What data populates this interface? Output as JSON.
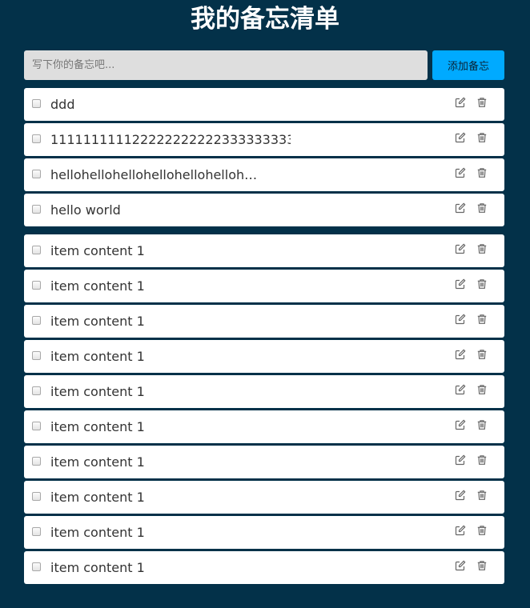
{
  "header": {
    "title": "我的备忘清单"
  },
  "composer": {
    "placeholder": "写下你的备忘吧...",
    "value": "",
    "add_label": "添加备忘"
  },
  "icons": {
    "edit": "edit-icon",
    "delete": "trash-icon"
  },
  "colors": {
    "background": "#033149",
    "accent_button": "#00aaff",
    "input_background": "#dedede",
    "item_background": "#ffffff"
  },
  "memos": [
    {
      "text": "ddd",
      "checked": false
    },
    {
      "text": "11111111112222222222233333333333…",
      "checked": false
    },
    {
      "text": "hellohellohellohellohellohelloh…",
      "checked": false
    },
    {
      "text": "hello world",
      "checked": false
    },
    {
      "text": "item content 1",
      "checked": false
    },
    {
      "text": "item content 1",
      "checked": false
    },
    {
      "text": "item content 1",
      "checked": false
    },
    {
      "text": "item content 1",
      "checked": false
    },
    {
      "text": "item content 1",
      "checked": false
    },
    {
      "text": "item content 1",
      "checked": false
    },
    {
      "text": "item content 1",
      "checked": false
    },
    {
      "text": "item content 1",
      "checked": false
    },
    {
      "text": "item content 1",
      "checked": false
    },
    {
      "text": "item content 1",
      "checked": false
    }
  ]
}
